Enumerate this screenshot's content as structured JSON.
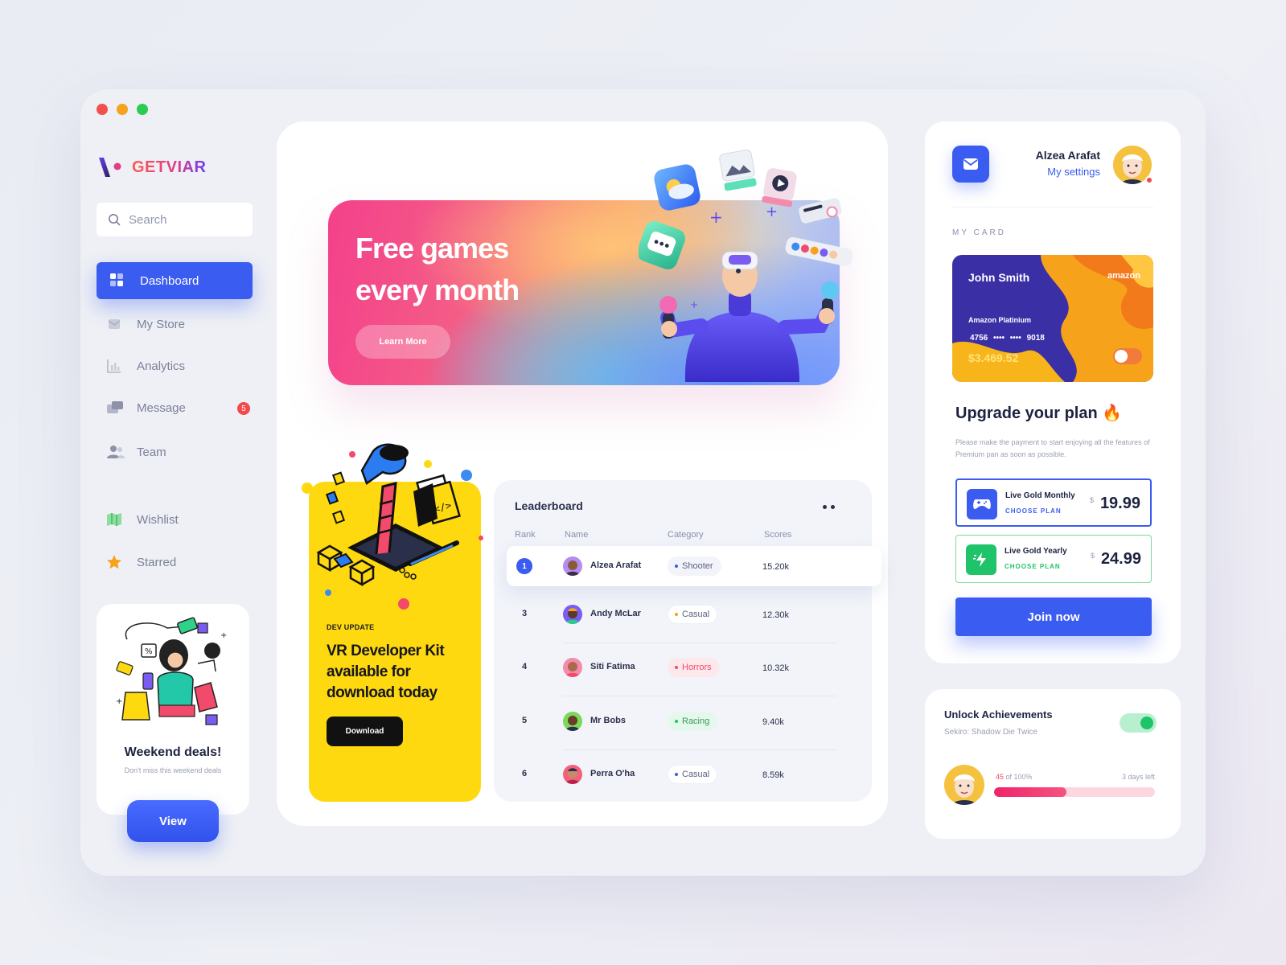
{
  "window": {
    "controls": [
      "close",
      "minimize",
      "maximize"
    ]
  },
  "brand": {
    "name": "GETVIAR"
  },
  "search": {
    "placeholder": "Search"
  },
  "sidebar": {
    "items": [
      {
        "label": "Dashboard",
        "icon": "dashboard-icon",
        "active": true
      },
      {
        "label": "My Store",
        "icon": "store-icon"
      },
      {
        "label": "Analytics",
        "icon": "analytics-icon"
      },
      {
        "label": "Message",
        "icon": "message-icon",
        "badge": "5"
      },
      {
        "label": "Team",
        "icon": "team-icon"
      },
      {
        "label": "Wishlist",
        "icon": "wishlist-icon"
      },
      {
        "label": "Starred",
        "icon": "star-icon"
      }
    ]
  },
  "promo": {
    "title": "Weekend deals!",
    "subtitle": "Don't miss this weekend deals",
    "button": "View"
  },
  "hero": {
    "title": "Free games every month",
    "button": "Learn More"
  },
  "dev_update": {
    "tag": "DEV UPDATE",
    "title": "VR Developer Kit available for download today",
    "button": "Download"
  },
  "leaderboard": {
    "title": "Leaderboard",
    "columns": [
      "Rank",
      "Name",
      "Category",
      "Scores"
    ],
    "rows": [
      {
        "rank": "1",
        "name": "Alzea Arafat",
        "category": "Shooter",
        "cat_color": "#3a5cf0",
        "score": "15.20k",
        "highlight": true
      },
      {
        "rank": "3",
        "name": "Andy McLar",
        "category": "Casual",
        "cat_color": "#f6a21b",
        "score": "12.30k"
      },
      {
        "rank": "4",
        "name": "Siti Fatima",
        "category": "Horrors",
        "cat_color": "#f24a6a",
        "score": "10.32k"
      },
      {
        "rank": "5",
        "name": "Mr Bobs",
        "category": "Racing",
        "cat_color": "#1fc46a",
        "score": "9.40k"
      },
      {
        "rank": "6",
        "name": "Perra O'ha",
        "category": "Casual",
        "cat_color": "#3a5cf0",
        "score": "8.59k"
      }
    ]
  },
  "user": {
    "name": "Alzea Arafat",
    "settings": "My settings"
  },
  "card": {
    "label": "MY CARD",
    "holder": "John Smith",
    "brand": "amazon",
    "type": "Amazon Platinium",
    "number": "4756 •••• •••• 9018",
    "balance": "$3.469.52"
  },
  "upgrade": {
    "title": "Upgrade your plan",
    "emoji": "🔥",
    "description": "Please make the payment to start enjoying all the features of Premium pan as soon as possible.",
    "plans": [
      {
        "name": "Live Gold Monthly",
        "choose": "CHOOSE PLAN",
        "currency": "$",
        "price": "19.99",
        "selected": true
      },
      {
        "name": "Live Gold Yearly",
        "choose": "CHOOSE PLAN",
        "currency": "$",
        "price": "24.99",
        "selected": false
      }
    ],
    "button": "Join now"
  },
  "achievements": {
    "title": "Unlock Achievements",
    "subtitle": "Sekiro: Shadow Die Twice",
    "enabled": true,
    "progress_value": "45",
    "progress_suffix": " of 100%",
    "progress": 0.45,
    "days_left": "3 days left"
  },
  "colors": {
    "accent": "#3a5cf0",
    "yellow": "#ffd90f",
    "green": "#1fc46a",
    "red": "#f24a4a"
  }
}
